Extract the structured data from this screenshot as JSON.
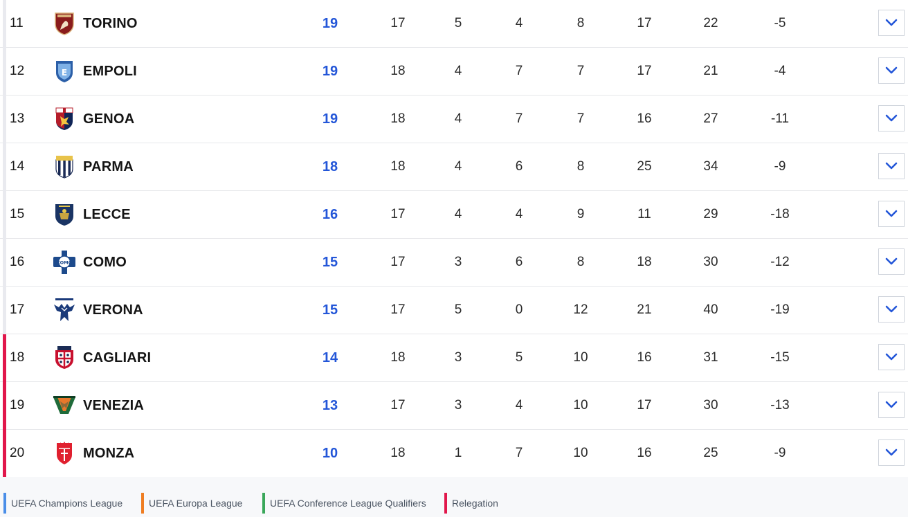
{
  "colors": {
    "points": "#2356d8",
    "relegation": "#e1174b",
    "champions_league": "#4a8ee8",
    "europa_league": "#ef7d22",
    "conference_league": "#3aa75a"
  },
  "rows": [
    {
      "pos": "11",
      "team": "TORINO",
      "pts": "19",
      "played": "17",
      "won": "5",
      "drawn": "4",
      "lost": "8",
      "gf": "17",
      "ga": "22",
      "gd": "-5",
      "zone": "none",
      "crest_icon": "torino-crest-icon"
    },
    {
      "pos": "12",
      "team": "EMPOLI",
      "pts": "19",
      "played": "18",
      "won": "4",
      "drawn": "7",
      "lost": "7",
      "gf": "17",
      "ga": "21",
      "gd": "-4",
      "zone": "none",
      "crest_icon": "empoli-crest-icon"
    },
    {
      "pos": "13",
      "team": "GENOA",
      "pts": "19",
      "played": "18",
      "won": "4",
      "drawn": "7",
      "lost": "7",
      "gf": "16",
      "ga": "27",
      "gd": "-11",
      "zone": "none",
      "crest_icon": "genoa-crest-icon"
    },
    {
      "pos": "14",
      "team": "PARMA",
      "pts": "18",
      "played": "18",
      "won": "4",
      "drawn": "6",
      "lost": "8",
      "gf": "25",
      "ga": "34",
      "gd": "-9",
      "zone": "none",
      "crest_icon": "parma-crest-icon"
    },
    {
      "pos": "15",
      "team": "LECCE",
      "pts": "16",
      "played": "17",
      "won": "4",
      "drawn": "4",
      "lost": "9",
      "gf": "11",
      "ga": "29",
      "gd": "-18",
      "zone": "none",
      "crest_icon": "lecce-crest-icon"
    },
    {
      "pos": "16",
      "team": "COMO",
      "pts": "15",
      "played": "17",
      "won": "3",
      "drawn": "6",
      "lost": "8",
      "gf": "18",
      "ga": "30",
      "gd": "-12",
      "zone": "none",
      "crest_icon": "como-crest-icon"
    },
    {
      "pos": "17",
      "team": "VERONA",
      "pts": "15",
      "played": "17",
      "won": "5",
      "drawn": "0",
      "lost": "12",
      "gf": "21",
      "ga": "40",
      "gd": "-19",
      "zone": "none",
      "crest_icon": "verona-crest-icon"
    },
    {
      "pos": "18",
      "team": "CAGLIARI",
      "pts": "14",
      "played": "18",
      "won": "3",
      "drawn": "5",
      "lost": "10",
      "gf": "16",
      "ga": "31",
      "gd": "-15",
      "zone": "relegation",
      "crest_icon": "cagliari-crest-icon"
    },
    {
      "pos": "19",
      "team": "VENEZIA",
      "pts": "13",
      "played": "17",
      "won": "3",
      "drawn": "4",
      "lost": "10",
      "gf": "17",
      "ga": "30",
      "gd": "-13",
      "zone": "relegation",
      "crest_icon": "venezia-crest-icon"
    },
    {
      "pos": "20",
      "team": "MONZA",
      "pts": "10",
      "played": "18",
      "won": "1",
      "drawn": "7",
      "lost": "10",
      "gf": "16",
      "ga": "25",
      "gd": "-9",
      "zone": "relegation",
      "crest_icon": "monza-crest-icon"
    }
  ],
  "legend": [
    {
      "label": "UEFA Champions League",
      "color": "#4a8ee8"
    },
    {
      "label": "UEFA Europa League",
      "color": "#ef7d22"
    },
    {
      "label": "UEFA Conference League Qualifiers",
      "color": "#3aa75a"
    },
    {
      "label": "Relegation",
      "color": "#e1174b"
    }
  ]
}
